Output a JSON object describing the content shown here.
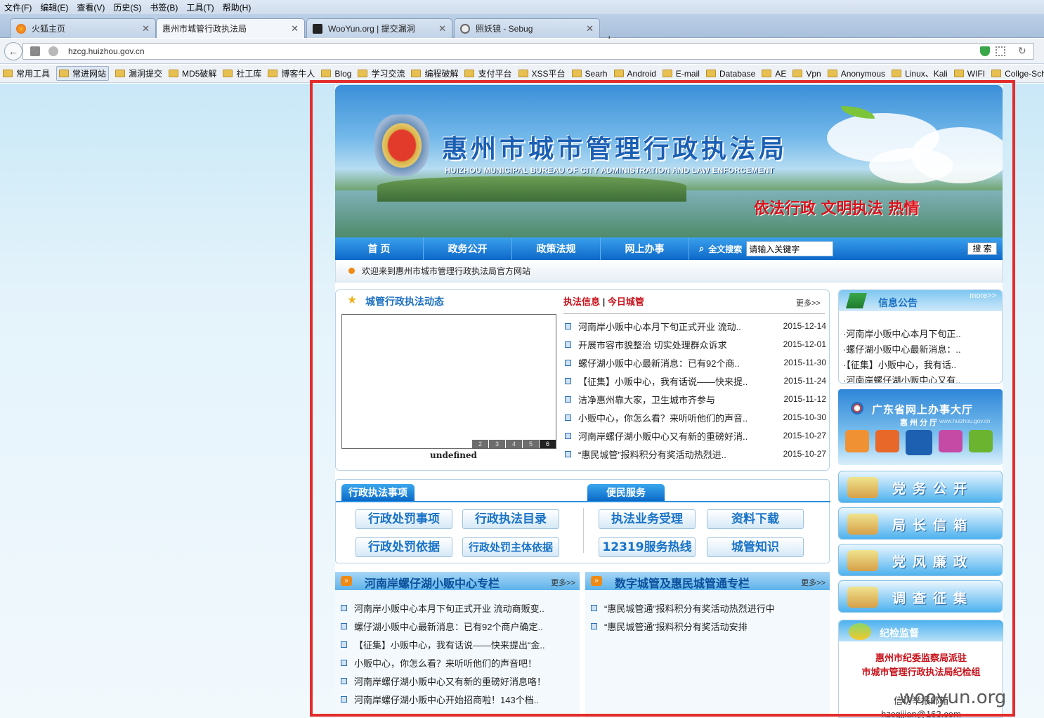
{
  "browser": {
    "menu": [
      "文件(F)",
      "编辑(E)",
      "查看(V)",
      "历史(S)",
      "书签(B)",
      "工具(T)",
      "帮助(H)"
    ],
    "tabs": [
      {
        "label": "火狐主页"
      },
      {
        "label": "惠州市城管行政执法局"
      },
      {
        "label": "WooYun.org | 提交漏洞"
      },
      {
        "label": "照妖镜 - Sebug"
      }
    ],
    "new_tab": "+",
    "url": "hzcg.huizhou.gov.cn",
    "bookmarks": [
      "常用工具",
      "常进网站",
      "漏洞提交",
      "MD5破解",
      "社工库",
      "博客牛人",
      "Blog",
      "学习交流",
      "编程破解",
      "支付平台",
      "XSS平台",
      "Searh",
      "Android",
      "E-mail",
      "Database",
      "AE",
      "Vpn",
      "Anonymous",
      "Linux、Kali",
      "WIFI",
      "Collge-School"
    ]
  },
  "site": {
    "title": "惠州市城市管理行政执法局",
    "subtitle": "HUIZHOU MUNICIPAL BUREAU OF CITY ADMINISTRATION AND LAW ENFORCEMENT",
    "slogan": "依法行政  文明执法  热情",
    "nav": [
      "首 页",
      "政务公开",
      "政策法规",
      "网上办事"
    ],
    "search_label": "全文搜索",
    "search_placeholder": "请输入关键字",
    "search_button": "搜 索",
    "welcome": "欢迎来到惠州市城市管理行政执法局官方网站"
  },
  "dynamics": {
    "title": "城管行政执法动态",
    "tab1": "执法信息",
    "sep": "|",
    "tab2": "今日城管",
    "more": "更多>>",
    "slide_caption": "undefined",
    "pager": [
      "2",
      "3",
      "4",
      "5",
      "6"
    ],
    "news": [
      {
        "title": "河南岸小贩中心本月下旬正式开业 流动..",
        "date": "2015-12-14"
      },
      {
        "title": "开展市容市貌整治 切实处理群众诉求",
        "date": "2015-12-01"
      },
      {
        "title": "螺仔湖小贩中心最新消息：已有92个商..",
        "date": "2015-11-30"
      },
      {
        "title": "【征集】小贩中心，我有话说——快来提..",
        "date": "2015-11-24"
      },
      {
        "title": "洁净惠州靠大家，卫生城市齐参与",
        "date": "2015-11-12"
      },
      {
        "title": "小贩中心，你怎么看？来听听他们的声音..",
        "date": "2015-10-30"
      },
      {
        "title": "河南岸螺仔湖小贩中心又有新的重磅好消..",
        "date": "2015-10-27"
      },
      {
        "title": "“惠民城管”报料积分有奖活动热烈进..",
        "date": "2015-10-27"
      }
    ]
  },
  "notice": {
    "title": "信息公告",
    "more": "more>>",
    "items": [
      "·河南岸小贩中心本月下旬正..",
      "·螺仔湖小贩中心最新消息：..",
      "·【征集】小贩中心，我有话..",
      "·河南岸螺仔湖小贩中心又有.."
    ]
  },
  "gd_hall": {
    "title": "广东省网上办事大厅",
    "sub": "惠 州 分 厅",
    "url": "www.huizhou.gov.cn"
  },
  "services": {
    "left_title": "行政执法事项",
    "right_title": "便民服务",
    "left_buttons": [
      "行政处罚事项",
      "行政执法目录",
      "行政处罚依据",
      "行政处罚主体依据"
    ],
    "right_buttons": [
      "执法业务受理",
      "资料下载",
      "12319服务热线",
      "城管知识"
    ]
  },
  "big_buttons": [
    "党务公开",
    "局长信箱",
    "党风廉政",
    "调查征集"
  ],
  "hawker": {
    "title": "河南岸螺仔湖小贩中心专栏",
    "more": "更多>>",
    "items": [
      "河南岸小贩中心本月下旬正式开业 流动商贩变..",
      "螺仔湖小贩中心最新消息：已有92个商户确定..",
      "【征集】小贩中心，我有话说——快来提出“金..",
      "小贩中心，你怎么看？来听听他们的声音吧！",
      "河南岸螺仔湖小贩中心又有新的重磅好消息咯！",
      "河南岸螺仔湖小贩中心开始招商啦！143个档.."
    ]
  },
  "digital": {
    "title": "数字城管及惠民城管通专栏",
    "more": "更多>>",
    "items": [
      "“惠民城管通”报料积分有奖活动热烈进行中",
      "“惠民城管通”报料积分有奖活动安排"
    ]
  },
  "discipline": {
    "title": "纪检监督",
    "line1": "惠州市纪委监察局派驻",
    "line2": "市城市管理行政执法局纪检组",
    "line3": "信访举报邮箱",
    "line4": "hzcgjjian@163.com"
  },
  "watermark": "wooyun.org",
  "colors": {
    "red_frame": "#e32c2c",
    "nav_blue": "#0d68c8",
    "title_blue": "#1a5fb4",
    "slogan_red": "#d9121b",
    "date_red": "#c8121b"
  }
}
